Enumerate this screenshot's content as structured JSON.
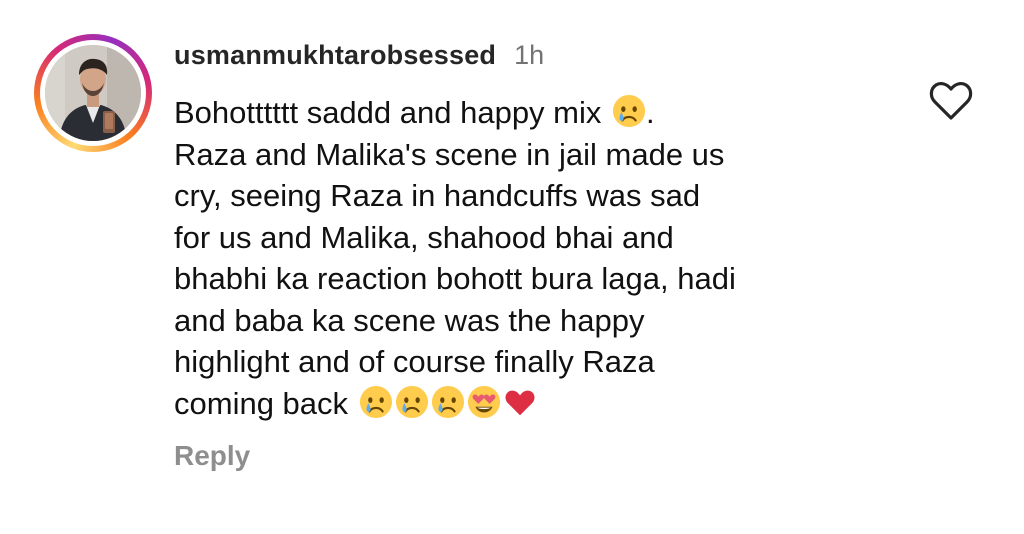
{
  "comment": {
    "username": "usmanmukhtarobsessed",
    "time": "1h",
    "lines": [
      "Bohotttttt saddd and happy mix",
      "Raza and Malika's scene in jail made us",
      "cry, seeing Raza in handcuffs was sad",
      "for us and Malika, shahood bhai and",
      "bhabhi ka reaction bohott bura laga, hadi",
      "and baba ka scene was the happy",
      "highlight and of course finally Raza",
      "coming back"
    ],
    "line1_suffix": ".",
    "emojis": {
      "line1": [
        "crying-face"
      ],
      "last_line": [
        "crying-face",
        "crying-face",
        "crying-face",
        "heart-eyes-face",
        "red-heart"
      ]
    },
    "reply_label": "Reply",
    "like_icon": "heart-outline-icon"
  },
  "colors": {
    "username": "#262626",
    "timestamp": "#737373",
    "reply": "#8e8e8e",
    "story_ring": [
      "#feda75",
      "#fa7e1e",
      "#d62976",
      "#962fbf"
    ]
  }
}
